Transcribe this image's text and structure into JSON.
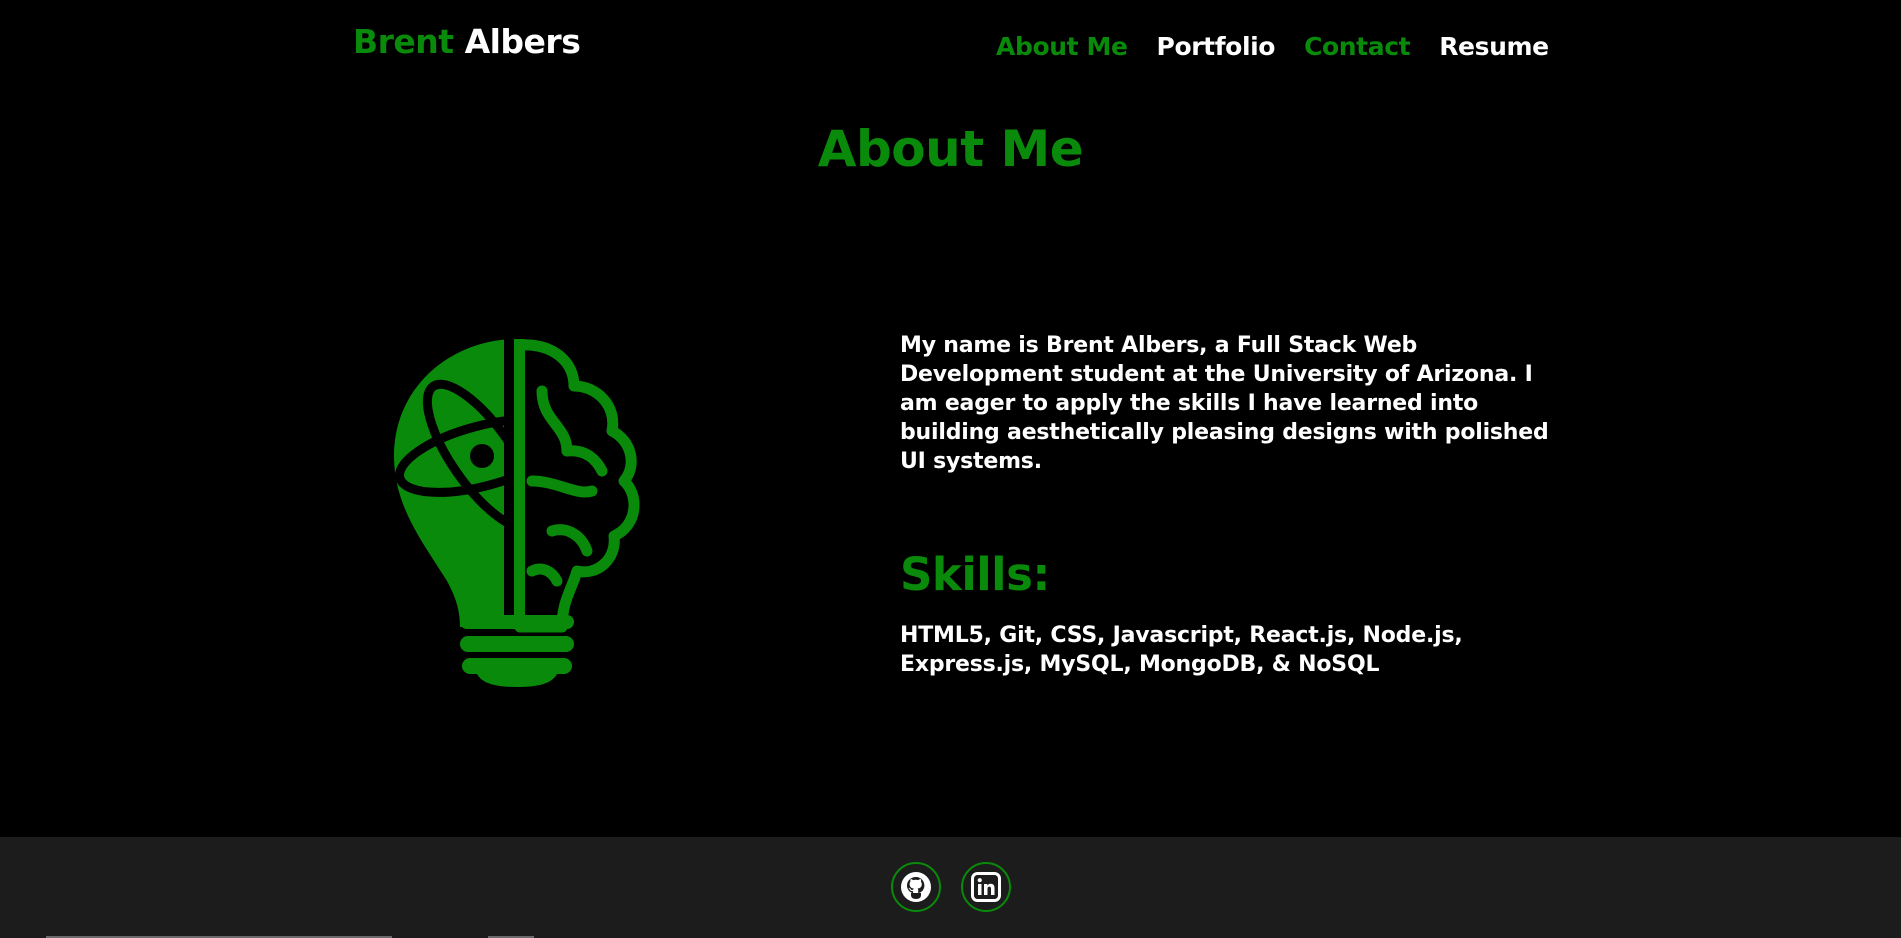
{
  "header": {
    "brand_first": "Brent",
    "brand_last": "Albers",
    "nav": [
      {
        "label": "About Me",
        "color": "#0a8a0a"
      },
      {
        "label": "Portfolio",
        "color": "#ffffff"
      },
      {
        "label": "Contact",
        "color": "#0a8a0a"
      },
      {
        "label": "Resume",
        "color": "#ffffff"
      }
    ]
  },
  "about": {
    "title": "About Me",
    "image_icon": "lightbulb-brain-atom-icon",
    "bio": "My name is Brent Albers, a Full Stack Web Development student at the University of Arizona. I am eager to apply the skills I have learned into building aesthetically pleasing designs with polished UI systems.",
    "skills_title": "Skills:",
    "skills": "HTML5, Git, CSS, Javascript, React.js, Node.js, Express.js, MySQL, MongoDB, & NoSQL"
  },
  "footer": {
    "links": [
      {
        "icon": "github-icon"
      },
      {
        "icon": "linkedin-icon"
      }
    ]
  },
  "colors": {
    "accent": "#0a8a0a",
    "background": "#000000",
    "footer": "#1c1c1c",
    "text": "#ffffff"
  }
}
